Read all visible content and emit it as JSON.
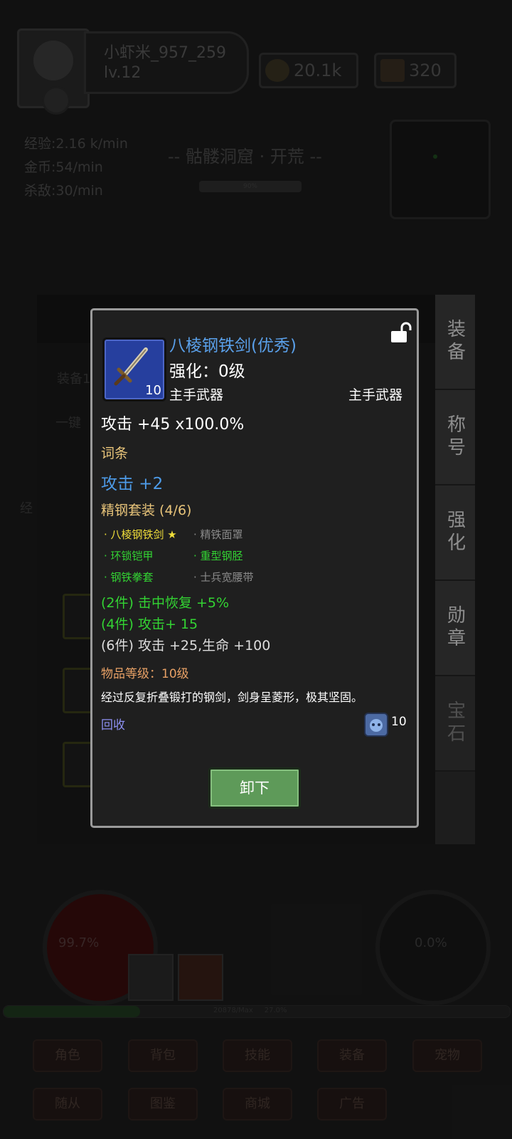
{
  "player": {
    "name": "小虾米_957_259",
    "level": "lv.12"
  },
  "resources": {
    "gold": "20.1k",
    "ingots": "320"
  },
  "rates": {
    "exp": "经验:2.16 k/min",
    "gold": "金币:54/min",
    "kills": "杀敌:30/min"
  },
  "zone": {
    "title": "-- 骷髅洞窟 · 开荒 --",
    "progress": "90%"
  },
  "panel": {
    "equip_label": "装备1",
    "one_key": "一键",
    "side_label": "经"
  },
  "hud": {
    "hp_percent": "99.7%",
    "mp_percent": "0.0%",
    "xp_text": "20878/Max",
    "xp_percent": "27.0%",
    "xp_fill": 0.27
  },
  "menu": {
    "row1": [
      "角色",
      "背包",
      "技能",
      "装备",
      "宠物"
    ],
    "row2": [
      "随从",
      "图鉴",
      "商城",
      "广告"
    ]
  },
  "side_tabs": [
    "装备",
    "称号",
    "强化",
    "勋章",
    "宝石"
  ],
  "item": {
    "name": "八棱钢铁剑(优秀)",
    "count": "10",
    "enhance": "强化：0级",
    "slot_left": "主手武器",
    "slot_right": "主手武器",
    "attack": "攻击 +45  x100.0%",
    "affix_title": "词条",
    "affix": "攻击 +2",
    "set_title": "精钢套装 (4/6)",
    "set_pieces": [
      {
        "name": "· 八棱钢铁剑 ★",
        "state": "current"
      },
      {
        "name": "· 精铁面罩",
        "state": "missing"
      },
      {
        "name": "· 环锁铠甲",
        "state": "owned"
      },
      {
        "name": "· 重型钢胫",
        "state": "owned"
      },
      {
        "name": "· 钢铁拳套",
        "state": "owned"
      },
      {
        "name": "· 士兵宽腰带",
        "state": "missing"
      }
    ],
    "set_bonuses": [
      {
        "text": "(2件) 击中恢复 +5%",
        "active": true
      },
      {
        "text": "(4件) 攻击+ 15",
        "active": true
      },
      {
        "text": "(6件) 攻击 +25,生命 +100",
        "active": false
      }
    ],
    "item_level": "物品等级：10级",
    "description": "经过反复折叠锻打的钢剑，剑身呈菱形，极其坚固。",
    "recycle": "回收",
    "recycle_value": "10",
    "unequip": "卸下"
  },
  "colors": {
    "item_name": "#5aa0ea",
    "affix": "#4d9be8",
    "set_title": "#e8c47a",
    "active": "#33d433",
    "inactive": "#dddddd",
    "item_level": "#e7a065",
    "recycle": "#8c8ff0",
    "button": "#5e9a59"
  }
}
